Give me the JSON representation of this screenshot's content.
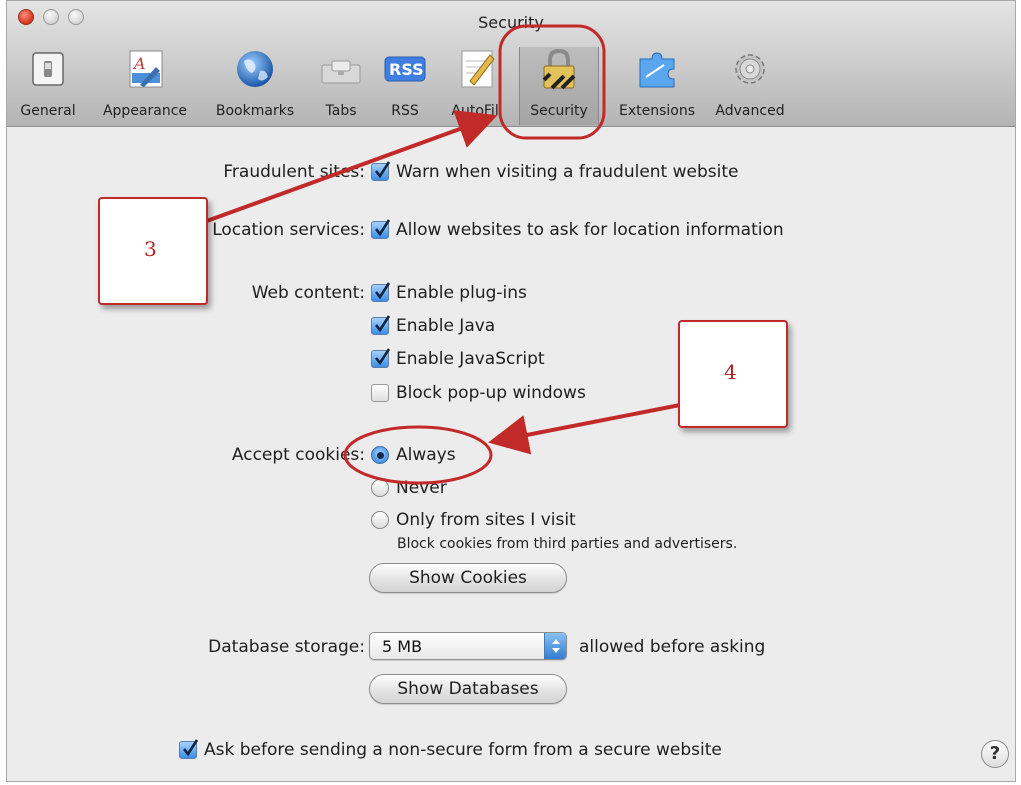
{
  "window": {
    "title": "Security"
  },
  "toolbar": {
    "items": [
      {
        "label": "General",
        "icon": "general-switch-icon"
      },
      {
        "label": "Appearance",
        "icon": "appearance-font-icon"
      },
      {
        "label": "Bookmarks",
        "icon": "globe-icon"
      },
      {
        "label": "Tabs",
        "icon": "tabs-icon"
      },
      {
        "label": "RSS",
        "icon": "rss-icon"
      },
      {
        "label": "AutoFill",
        "icon": "pencil-icon"
      },
      {
        "label": "Security",
        "icon": "lock-icon",
        "selected": true
      },
      {
        "label": "Extensions",
        "icon": "puzzle-icon"
      },
      {
        "label": "Advanced",
        "icon": "gear-icon"
      }
    ]
  },
  "security": {
    "fraudulent": {
      "label": "Fraudulent sites:",
      "option": "Warn when visiting a fraudulent website",
      "checked": true
    },
    "location": {
      "label": "Location services:",
      "option": "Allow websites to ask for location information",
      "checked": true
    },
    "web_content": {
      "label": "Web content:",
      "options": [
        {
          "text": "Enable plug-ins",
          "checked": true
        },
        {
          "text": "Enable Java",
          "checked": true
        },
        {
          "text": "Enable JavaScript",
          "checked": true
        },
        {
          "text": "Block pop-up windows",
          "checked": false
        }
      ]
    },
    "cookies": {
      "label": "Accept cookies:",
      "options": [
        {
          "text": "Always",
          "selected": true
        },
        {
          "text": "Never",
          "selected": false
        },
        {
          "text": "Only from sites I visit",
          "selected": false
        }
      ],
      "note": "Block cookies from third parties and advertisers.",
      "show_button": "Show Cookies"
    },
    "database": {
      "label": "Database storage:",
      "value": "5 MB",
      "suffix": "allowed before asking",
      "show_button": "Show Databases"
    },
    "nonsecure": {
      "option": "Ask before sending a non-secure form from a secure website",
      "checked": true
    },
    "help": "?"
  },
  "annotations": {
    "callout_3": "3",
    "callout_4": "4",
    "color": "#c22a2a"
  }
}
